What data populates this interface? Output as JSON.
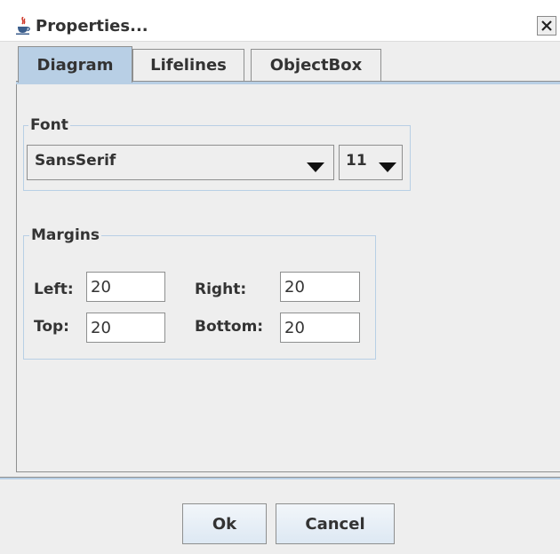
{
  "window": {
    "title": "Properties...",
    "close_label": "X"
  },
  "tabs": [
    {
      "label": "Diagram",
      "selected": true
    },
    {
      "label": "Lifelines",
      "selected": false
    },
    {
      "label": "ObjectBox",
      "selected": false
    }
  ],
  "font_group": {
    "title": "Font",
    "family_value": "SansSerif",
    "size_value": "11"
  },
  "margins_group": {
    "title": "Margins",
    "left_label": "Left:",
    "left_value": "20",
    "right_label": "Right:",
    "right_value": "20",
    "top_label": "Top:",
    "top_value": "20",
    "bottom_label": "Bottom:",
    "bottom_value": "20"
  },
  "buttons": {
    "ok": "Ok",
    "cancel": "Cancel"
  },
  "colors": {
    "accent": "#b8cfe5",
    "border": "#8e8f8f",
    "background": "#eeeeee"
  }
}
